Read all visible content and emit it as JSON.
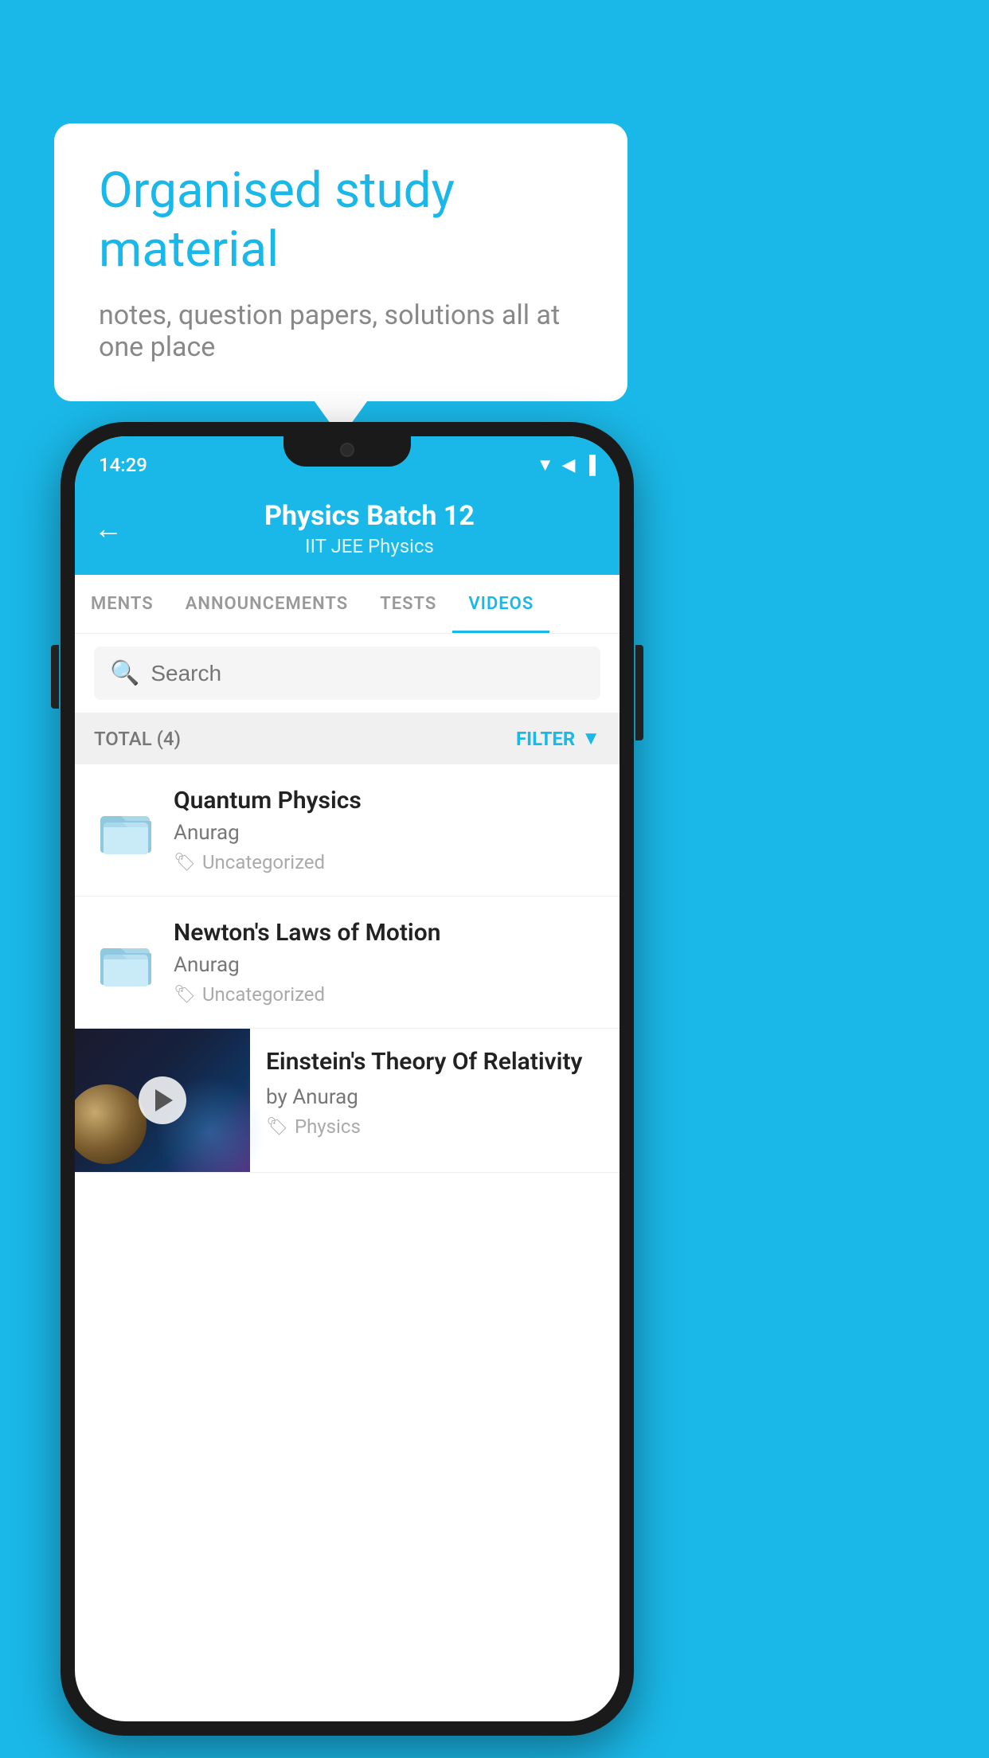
{
  "background_color": "#1ab8e8",
  "bubble": {
    "title": "Organised study material",
    "subtitle": "notes, question papers, solutions all at one place"
  },
  "status_bar": {
    "time": "14:29",
    "wifi_icon": "▲",
    "signal_icon": "▲",
    "battery_icon": "▐"
  },
  "header": {
    "title": "Physics Batch 12",
    "subtitle": "IIT JEE    Physics",
    "back_label": "←"
  },
  "tabs": [
    {
      "label": "MENTS",
      "active": false
    },
    {
      "label": "ANNOUNCEMENTS",
      "active": false
    },
    {
      "label": "TESTS",
      "active": false
    },
    {
      "label": "VIDEOS",
      "active": true
    }
  ],
  "search": {
    "placeholder": "Search"
  },
  "filter_bar": {
    "total_label": "TOTAL (4)",
    "filter_label": "FILTER"
  },
  "videos": [
    {
      "id": 1,
      "title": "Quantum Physics",
      "author": "Anurag",
      "tag": "Uncategorized",
      "type": "folder"
    },
    {
      "id": 2,
      "title": "Newton's Laws of Motion",
      "author": "Anurag",
      "tag": "Uncategorized",
      "type": "folder"
    },
    {
      "id": 3,
      "title": "Einstein's Theory Of Relativity",
      "author": "by Anurag",
      "tag": "Physics",
      "type": "video"
    }
  ]
}
